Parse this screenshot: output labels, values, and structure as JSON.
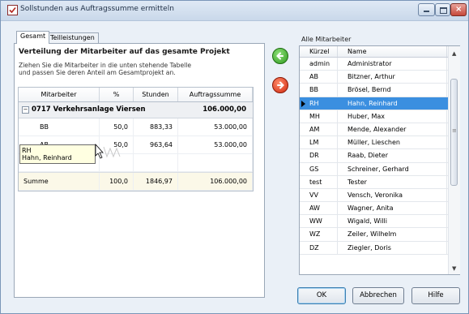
{
  "window": {
    "title": "Sollstunden aus Auftragssumme ermitteln"
  },
  "tabs": [
    "Gesamt",
    "Teilleistungen"
  ],
  "left": {
    "heading": "Verteilung der Mitarbeiter auf das gesamte Projekt",
    "instruction_line1": "Ziehen Sie die Mitarbeiter in die unten stehende Tabelle",
    "instruction_line2": "und passen Sie deren Anteil am Gesamtprojekt an.",
    "columns": [
      "Mitarbeiter",
      "%",
      "Stunden",
      "Auftragssumme"
    ],
    "group": {
      "expander": "−",
      "label": "0717 Verkehrsanlage Viersen",
      "total": "106.000,00"
    },
    "rows": [
      {
        "mitarbeiter": "BB",
        "percent": "50,0",
        "stunden": "883,33",
        "summe": "53.000,00"
      },
      {
        "mitarbeiter": "AB",
        "percent": "50,0",
        "stunden": "963,64",
        "summe": "53.000,00"
      }
    ],
    "sum_row": {
      "label": "Summe",
      "percent": "100,0",
      "stunden": "1846,97",
      "summe": "106.000,00"
    },
    "tooltip": {
      "line1": "RH",
      "line2": "Hahn, Reinhard"
    }
  },
  "right": {
    "label": "Alle Mitarbeiter",
    "columns": [
      "Kürzel",
      "Name"
    ],
    "selected_index": 3,
    "rows": [
      {
        "kuerzel": "admin",
        "name": "Administrator"
      },
      {
        "kuerzel": "AB",
        "name": "Bitzner, Arthur"
      },
      {
        "kuerzel": "BB",
        "name": "Brösel, Bernd"
      },
      {
        "kuerzel": "RH",
        "name": "Hahn, Reinhard"
      },
      {
        "kuerzel": "MH",
        "name": "Huber, Max"
      },
      {
        "kuerzel": "AM",
        "name": "Mende, Alexander"
      },
      {
        "kuerzel": "LM",
        "name": "Müller, Lieschen"
      },
      {
        "kuerzel": "DR",
        "name": "Raab, Dieter"
      },
      {
        "kuerzel": "GS",
        "name": "Schreiner, Gerhard"
      },
      {
        "kuerzel": "test",
        "name": "Tester"
      },
      {
        "kuerzel": "VV",
        "name": "Vensch, Veronika"
      },
      {
        "kuerzel": "AW",
        "name": "Wagner, Anita"
      },
      {
        "kuerzel": "WW",
        "name": "Wigald, Willi"
      },
      {
        "kuerzel": "WZ",
        "name": "Zeiler, Wilhelm"
      },
      {
        "kuerzel": "DZ",
        "name": "Ziegler, Doris"
      }
    ]
  },
  "buttons": {
    "ok": "OK",
    "cancel": "Abbrechen",
    "help": "Hilfe"
  },
  "colors": {
    "selection": "#3b8fe0",
    "add_arrow": "#2f9a1e",
    "remove_arrow": "#d02a10",
    "tooltip_bg": "#ffffe1"
  }
}
